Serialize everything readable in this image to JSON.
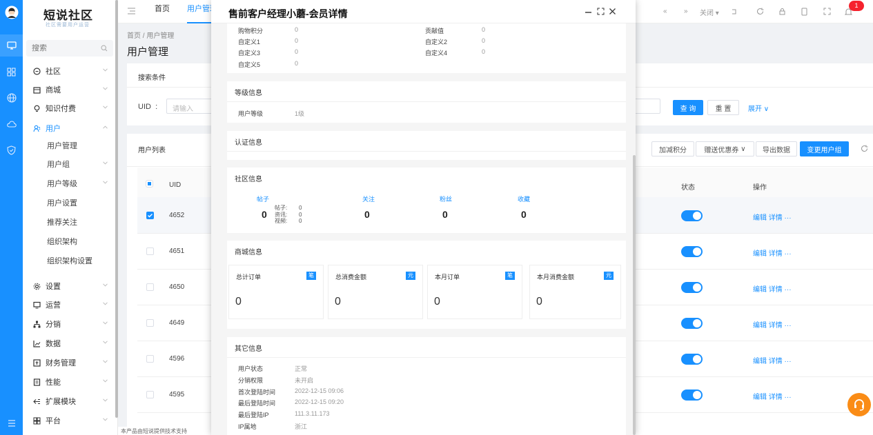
{
  "app": {
    "logo_title": "短说社区",
    "logo_subtitle": "社区需要用户运营"
  },
  "rail": {
    "icons": [
      "avatar",
      "monitor-icon",
      "grid-icon",
      "globe-icon",
      "cloud-icon",
      "shield-icon",
      "menu-icon"
    ]
  },
  "sidebar": {
    "search_placeholder": "搜索",
    "items": [
      {
        "label": "社区",
        "icon": "chat-icon"
      },
      {
        "label": "商城",
        "icon": "shop-icon"
      },
      {
        "label": "知识付费",
        "icon": "bulb-icon"
      },
      {
        "label": "用户",
        "icon": "user-icon"
      },
      {
        "label": "设置",
        "icon": "gear-icon"
      },
      {
        "label": "运营",
        "icon": "monitor-icon"
      },
      {
        "label": "分销",
        "icon": "tree-icon"
      },
      {
        "label": "数据",
        "icon": "chart-icon"
      },
      {
        "label": "财务管理",
        "icon": "finance-icon"
      },
      {
        "label": "性能",
        "icon": "doc-icon"
      },
      {
        "label": "扩展模块",
        "icon": "extend-icon"
      },
      {
        "label": "平台",
        "icon": "platform-icon"
      }
    ],
    "user_sub": [
      "用户管理",
      "用户组",
      "用户等级",
      "用户设置",
      "推荐关注",
      "组织架构",
      "组织架构设置"
    ]
  },
  "topbar": {
    "tabs": [
      "首页",
      "用户管理"
    ],
    "close_label": "关闭",
    "notification_count": "1"
  },
  "page": {
    "breadcrumb": "首页 / 用户管理",
    "title": "用户管理",
    "search_panel_title": "搜索条件",
    "uid_label": "UID",
    "uid_placeholder": "请输入",
    "query": "查 询",
    "reset": "重 置",
    "expand": "展开",
    "list_title": "用户列表",
    "btn_points": "加减积分",
    "btn_coupon": "赠送优惠券",
    "btn_export": "导出数据",
    "btn_change_group": "变更用户组",
    "col_uid": "UID",
    "col_status": "状态",
    "col_ops": "操作",
    "rows": [
      {
        "uid": "4652",
        "checked": true
      },
      {
        "uid": "4651",
        "checked": false
      },
      {
        "uid": "4650",
        "checked": false
      },
      {
        "uid": "4649",
        "checked": false
      },
      {
        "uid": "4596",
        "checked": false
      },
      {
        "uid": "4595",
        "checked": false
      }
    ],
    "ops_text": "编辑 详情 ···",
    "footer_text": "本产品由短说提供技术支持"
  },
  "drawer": {
    "title": "售前客户经理小蘑-会员详情",
    "top_fields": [
      {
        "k": "购物积分",
        "v": "0"
      },
      {
        "k": "贡献值",
        "v": "0"
      },
      {
        "k": "自定义1",
        "v": "0"
      },
      {
        "k": "自定义2",
        "v": "0"
      },
      {
        "k": "自定义3",
        "v": "0"
      },
      {
        "k": "自定义4",
        "v": "0"
      },
      {
        "k": "自定义5",
        "v": "0"
      }
    ],
    "level": {
      "title": "等级信息",
      "k": "用户等级",
      "v": "1级"
    },
    "auth": {
      "title": "认证信息"
    },
    "community": {
      "title": "社区信息",
      "posts_label": "帖子",
      "posts_value": "0",
      "sub": [
        {
          "k": "帖子:",
          "v": "0"
        },
        {
          "k": "资讯:",
          "v": "0"
        },
        {
          "k": "视频:",
          "v": "0"
        }
      ],
      "follow_label": "关注",
      "follow_value": "0",
      "fans_label": "粉丝",
      "fans_value": "0",
      "fav_label": "收藏",
      "fav_value": "0"
    },
    "mall": {
      "title": "商城信息",
      "stats": [
        {
          "label": "总计订单",
          "badge": "笔",
          "value": "0"
        },
        {
          "label": "总消费金额",
          "badge": "元",
          "value": "0"
        },
        {
          "label": "本月订单",
          "badge": "笔",
          "value": "0"
        },
        {
          "label": "本月消费金额",
          "badge": "元",
          "value": "0"
        }
      ]
    },
    "other": {
      "title": "其它信息",
      "fields": [
        {
          "k": "用户状态",
          "v": "正常"
        },
        {
          "k": "分销权限",
          "v": "未开启"
        },
        {
          "k": "首次登陆时间",
          "v": "2022-12-15 09:06"
        },
        {
          "k": "最后登陆时间",
          "v": "2022-12-15 09:20"
        },
        {
          "k": "最后登陆IP",
          "v": "111.3.11.173"
        },
        {
          "k": "IP属地",
          "v": "浙江"
        }
      ]
    }
  },
  "colors": {
    "primary": "#1890ff",
    "notify": "#f5222d",
    "float_button": "#fa8c16"
  }
}
